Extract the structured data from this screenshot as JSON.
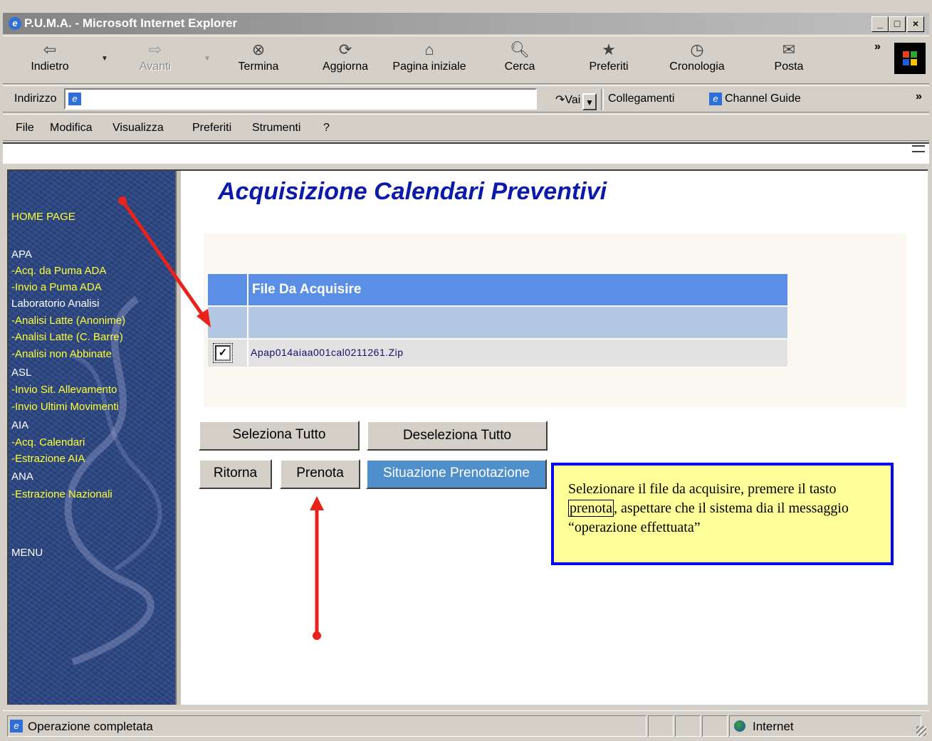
{
  "window": {
    "title": "P.U.M.A. - Microsoft Internet Explorer",
    "min": "_",
    "max": "□",
    "close": "×"
  },
  "toolbar": {
    "back": {
      "label": "Indietro",
      "icon": "⇦"
    },
    "forward": {
      "label": "Avanti",
      "icon": "⇨"
    },
    "stop": {
      "label": "Termina",
      "icon": "⊗"
    },
    "refresh": {
      "label": "Aggiorna",
      "icon": "⟳"
    },
    "home": {
      "label": "Pagina iniziale",
      "icon": "⌂"
    },
    "search": {
      "label": "Cerca",
      "icon": "🔍︎"
    },
    "favorites": {
      "label": "Preferiti",
      "icon": "★"
    },
    "history": {
      "label": "Cronologia",
      "icon": "◷"
    },
    "mail": {
      "label": "Posta",
      "icon": "✉"
    },
    "more": "»"
  },
  "address": {
    "label": "Indirizzo",
    "go": "Vai",
    "links": "Collegamenti",
    "channel": "Channel Guide",
    "more": "»"
  },
  "menu": [
    "File",
    "Modifica",
    "Visualizza",
    "Preferiti",
    "Strumenti",
    "?"
  ],
  "sidebar": [
    {
      "text": "HOME PAGE",
      "kind": "y"
    },
    {
      "text": "APA",
      "kind": "w"
    },
    {
      "text": "-Acq. da Puma ADA",
      "kind": "y"
    },
    {
      "text": "-Invio a Puma ADA",
      "kind": "y"
    },
    {
      "text": "Laboratorio Analisi",
      "kind": "w"
    },
    {
      "text": "-Analisi Latte (Anonime)",
      "kind": "y"
    },
    {
      "text": "-Analisi Latte (C. Barre)",
      "kind": "y"
    },
    {
      "text": "-Analisi non Abbinate",
      "kind": "y"
    },
    {
      "text": "ASL",
      "kind": "w"
    },
    {
      "text": "-Invio Sit. Allevamento",
      "kind": "y"
    },
    {
      "text": "-Invio Ultimi Movimenti",
      "kind": "y"
    },
    {
      "text": "AIA",
      "kind": "w"
    },
    {
      "text": "-Acq. Calendari",
      "kind": "y"
    },
    {
      "text": "-Estrazione AIA",
      "kind": "y"
    },
    {
      "text": "ANA",
      "kind": "w"
    },
    {
      "text": "-Estrazione Nazionali",
      "kind": "y"
    },
    {
      "text": "MENU",
      "kind": "w"
    }
  ],
  "page": {
    "title": "Acquisizione Calendari Preventivi",
    "table_header": "File Da Acquisire",
    "file_name": "Apap014aiaa001cal0211261.Zip",
    "checked": "☑"
  },
  "buttons": {
    "select_all": "Seleziona Tutto",
    "deselect_all": "Deseleziona Tutto",
    "back": "Ritorna",
    "book": "Prenota",
    "status": "Situazione Prenotazione"
  },
  "callout": {
    "part1": "Selezionare il file da acquisire,  premere il tasto ",
    "boxed": "prenota",
    "part2": ", aspettare che il sistema dia il messaggio “operazione effettuata”"
  },
  "statusbar": {
    "text": "Operazione completata",
    "zone": "Internet"
  },
  "colors": {
    "sidebar": "#2c4682",
    "title": "#0b1aa8",
    "table_header": "#5b8fe6",
    "arrow": "#e8231c",
    "callout_border": "#0000ee",
    "callout_bg": "#ffff99"
  }
}
